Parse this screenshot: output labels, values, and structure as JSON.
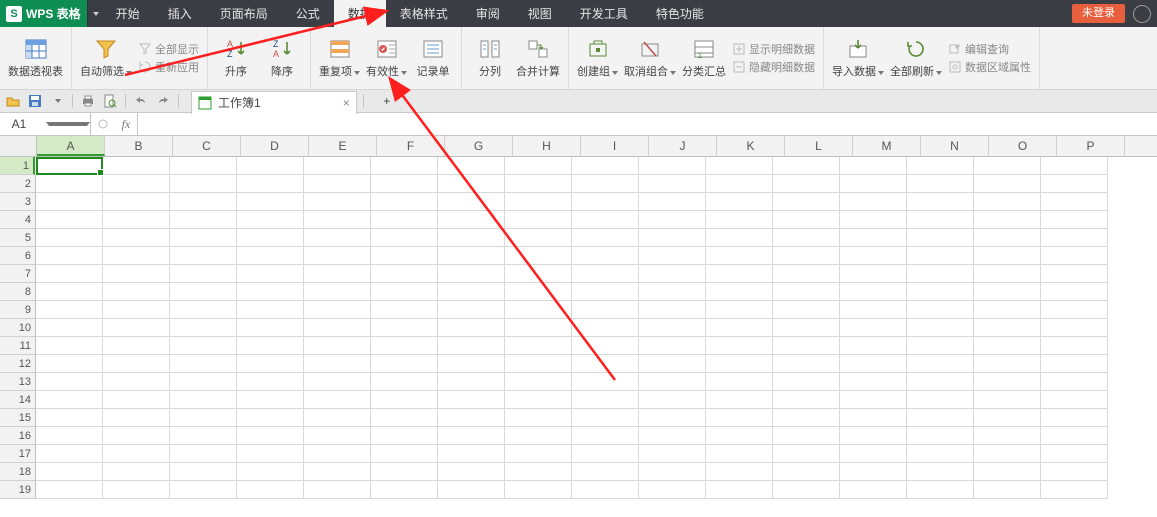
{
  "app": {
    "name": "WPS 表格",
    "login": "未登录"
  },
  "menu": {
    "tabs": [
      "开始",
      "插入",
      "页面布局",
      "公式",
      "数据",
      "表格样式",
      "审阅",
      "视图",
      "开发工具",
      "特色功能"
    ],
    "active_index": 4
  },
  "ribbon": {
    "pivot": "数据透视表",
    "autofilter": "自动筛选",
    "show_all": "全部显示",
    "reapply": "重新应用",
    "sort_asc": "升序",
    "sort_desc": "降序",
    "duplicates": "重复项",
    "validation": "有效性",
    "form": "记录单",
    "text_to_cols": "分列",
    "consolidate": "合并计算",
    "group": "创建组",
    "ungroup": "取消组合",
    "subtotal": "分类汇总",
    "show_detail": "显示明细数据",
    "hide_detail": "隐藏明细数据",
    "import": "导入数据",
    "refresh_all": "全部刷新",
    "edit_query": "编辑查询",
    "range_props": "数据区域属性"
  },
  "doc": {
    "tab_label": "工作簿1"
  },
  "cellref": {
    "name": "A1",
    "fx": "fx"
  },
  "columns": [
    "A",
    "B",
    "C",
    "D",
    "E",
    "F",
    "G",
    "H",
    "I",
    "J",
    "K",
    "L",
    "M",
    "N",
    "O",
    "P"
  ],
  "rows_visible": 19,
  "icons": {
    "logo_letter": "S",
    "caret": "▾",
    "close": "×",
    "plus": "+",
    "check": "✓"
  }
}
